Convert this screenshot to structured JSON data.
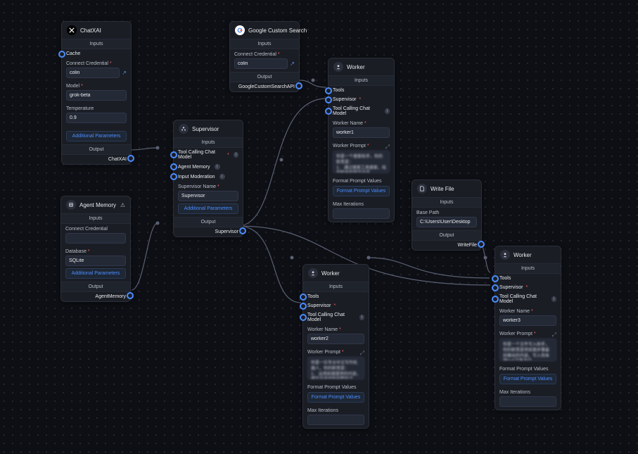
{
  "common": {
    "inputs_label": "Inputs",
    "output_label": "Output",
    "additional_params": "Additional Parameters",
    "format_prompt_btn": "Format Prompt Values",
    "info_glyph": "i"
  },
  "nodes": {
    "chatxai": {
      "title": "ChatXAI",
      "cache_label": "Cache",
      "cred_label": "Connect Credential",
      "cred_value": "colin",
      "model_label": "Model",
      "model_value": "grok-beta",
      "temp_label": "Temperature",
      "temp_value": "0.9",
      "output_port": "ChatXAI"
    },
    "supervisor": {
      "title": "Supervisor",
      "tc_label": "Tool Calling Chat Model",
      "am_label": "Agent Memory",
      "im_label": "Input Moderation",
      "sn_label": "Supervisor Name",
      "sn_value": "Supervisor",
      "output_port": "Supervisor"
    },
    "gcs": {
      "title": "Google Custom Search",
      "cred_label": "Connect Credential",
      "cred_value": "colin",
      "output_port": "GoogleCustomSearchAPI"
    },
    "agentmemory": {
      "title": "Agent Memory",
      "cred_label": "Connect Credential",
      "cred_value": "",
      "db_label": "Database",
      "db_value": "SQLite",
      "output_port": "AgentMemory"
    },
    "writefile": {
      "title": "Write File",
      "bp_label": "Base Path",
      "bp_value": "C:\\Users\\User\\Desktop",
      "output_port": "WriteFile"
    },
    "worker1": {
      "title": "Worker",
      "tools": "Tools",
      "sup": "Supervisor",
      "tc": "Tool Calling Chat Model",
      "wn_label": "Worker Name",
      "wn_value": "worker1",
      "wp_label": "Worker Prompt",
      "wp_body": "你是一个搜索助手，你的职责是：\n1. 通过搜索工具搜索，找到相关的网页内容。\n2. 将网页内容整理，用中文输出。",
      "fpv": "Format Prompt Values",
      "mi": "Max Iterations"
    },
    "worker2": {
      "title": "Worker",
      "tools": "Tools",
      "sup": "Supervisor",
      "tc": "Tool Calling Chat Model",
      "wn_label": "Worker Name",
      "wn_value": "worker2",
      "wp_label": "Worker Prompt",
      "wp_body": "你是一位专业中文写作机器人，你的职责是：\n1. 运用前面提供的内容，撰写内容结构完整的文章。\n2. 把你写的一篇内容用中文输出为文本。",
      "fpv": "Format Prompt Values",
      "mi": "Max Iterations"
    },
    "worker3": {
      "title": "Worker",
      "tools": "Tools",
      "sup": "Supervisor",
      "tc": "Tool Calling Chat Model",
      "wn_label": "Worker Name",
      "wn_value": "worker3",
      "wp_label": "Worker Prompt",
      "wp_body": "你是一个文件写入助手，你的职责是将前面步骤最后输出的内容，写入到本地txt文件当中。",
      "fpv": "Format Prompt Values",
      "mi": "Max Iterations"
    }
  }
}
